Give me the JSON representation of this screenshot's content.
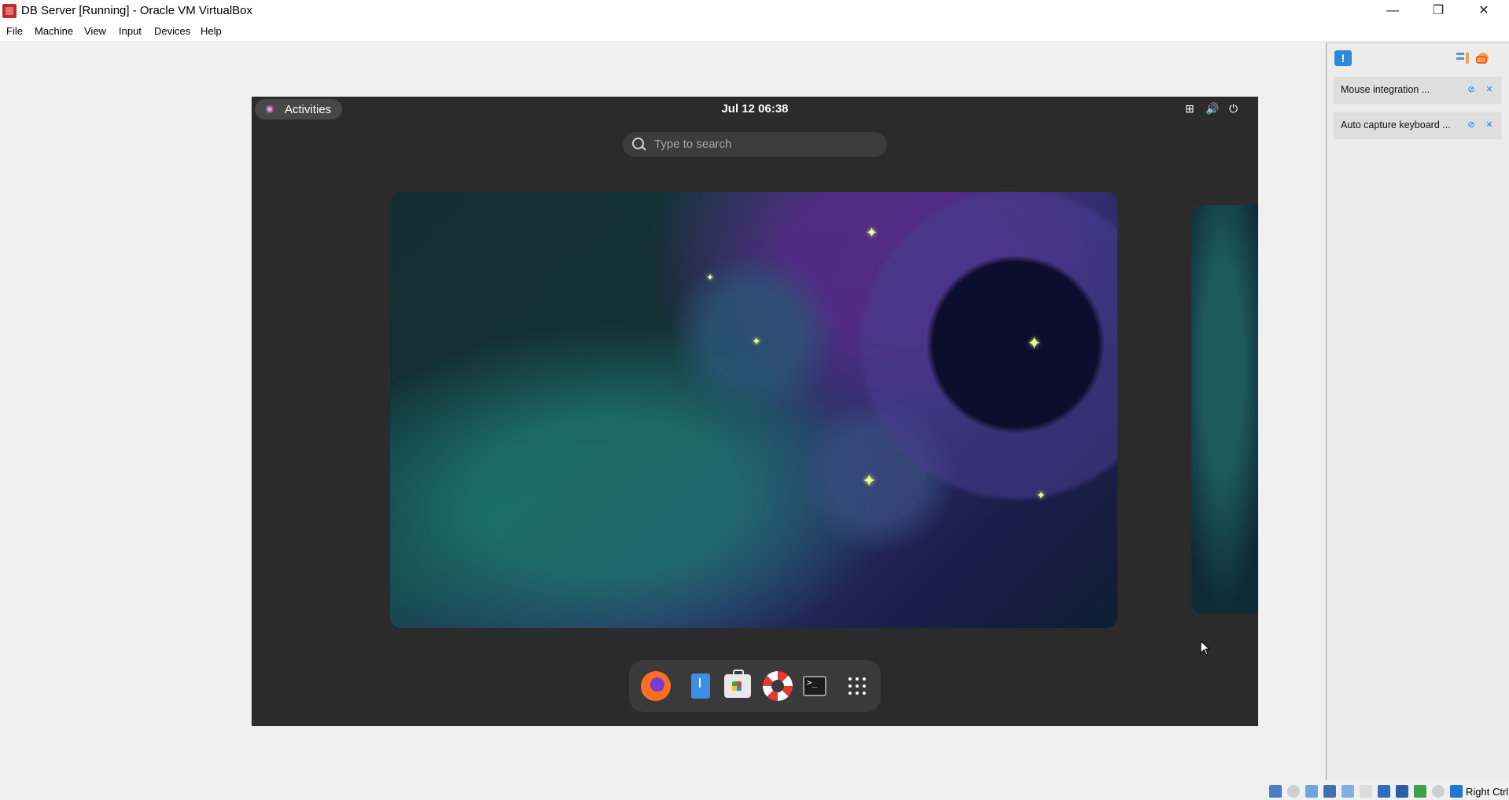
{
  "window": {
    "title": "DB Server [Running] - Oracle VM VirtualBox",
    "minimize_icon": "—",
    "restore_icon": "❐",
    "close_icon": "✕"
  },
  "menu": [
    "File",
    "Machine",
    "View",
    "Input",
    "Devices",
    "Help"
  ],
  "vm": {
    "activities_label": "Activities",
    "clock": "Jul 12  06:38",
    "tray": {
      "network_icon": "⊞",
      "volume_icon": "🔊",
      "power_icon": "⏻"
    },
    "search_placeholder": "Type to search",
    "dock": [
      {
        "name": "firefox-icon"
      },
      {
        "name": "files-icon"
      },
      {
        "name": "software-icon"
      },
      {
        "name": "help-icon"
      },
      {
        "name": "terminal-icon",
        "glyph": ">_"
      },
      {
        "name": "show-apps-icon"
      }
    ]
  },
  "notification_panel": {
    "alert_icon": "!",
    "items": [
      {
        "text": "Mouse integration ..."
      },
      {
        "text": "Auto capture keyboard ..."
      }
    ]
  },
  "status_bar": {
    "host_key": "Right Ctrl"
  }
}
